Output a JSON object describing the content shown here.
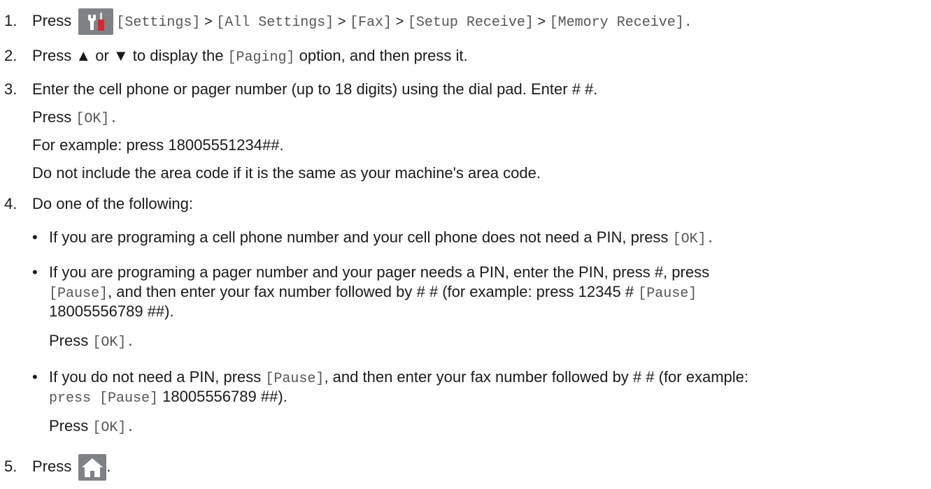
{
  "steps": {
    "s1": {
      "num": "1.",
      "press": "Press",
      "icon": "settings-icon",
      "path": [
        "[Settings]",
        " > ",
        "[All Settings]",
        " > ",
        "[Fax]",
        " > ",
        "[Setup Receive]",
        " > ",
        "[Memory Receive]",
        "."
      ]
    },
    "s2": {
      "num": "2.",
      "pre": "Press ▲ or ▼ to display the ",
      "option": "[Paging]",
      "post": " option, and then press it."
    },
    "s3": {
      "num": "3.",
      "text": "Enter the cell phone or pager number (up to 18 digits) using the dial pad. Enter # #.",
      "press": "Press ",
      "ok": "[OK]",
      "dot": ".",
      "example": "For example: press 18005551234##.",
      "note": "Do not include the area code if it is the same as your machine's area code."
    },
    "s4": {
      "num": "4.",
      "text": "Do one of the following:",
      "b1_pre": "If you are programing a cell phone number and your cell phone does not need a PIN, press ",
      "b1_ok": "[OK]",
      "b1_post": ".",
      "b2_l1": "If you are programing a pager number and your pager needs a PIN, enter the PIN, press #, press",
      "b2_l2_pause": "[Pause]",
      "b2_l2_mid": ", and then enter your fax number followed by # # (for example: press 12345 # ",
      "b2_l2_pause2": "[Pause]",
      "b2_l3": "18005556789 ##).",
      "b2_press": "Press ",
      "b2_ok": "[OK]",
      "b2_dot": ".",
      "b3_pre": "If you do not need a PIN, press ",
      "b3_pause": "[Pause]",
      "b3_mid": ", and then enter your fax number followed by # # (for example:",
      "b3_l2_pre": "press ",
      "b3_l2_pause": "[Pause]",
      "b3_l2_post": " 18005556789 ##).",
      "b3_press": "Press ",
      "b3_ok": "[OK]",
      "b3_dot": "."
    },
    "s5": {
      "num": "5.",
      "press": "Press",
      "icon": "home-icon",
      "dot": "."
    }
  },
  "colors": {
    "button_bg": "#7e8286",
    "wrench": "#ffffff",
    "screwdriver": "#d8262d"
  }
}
